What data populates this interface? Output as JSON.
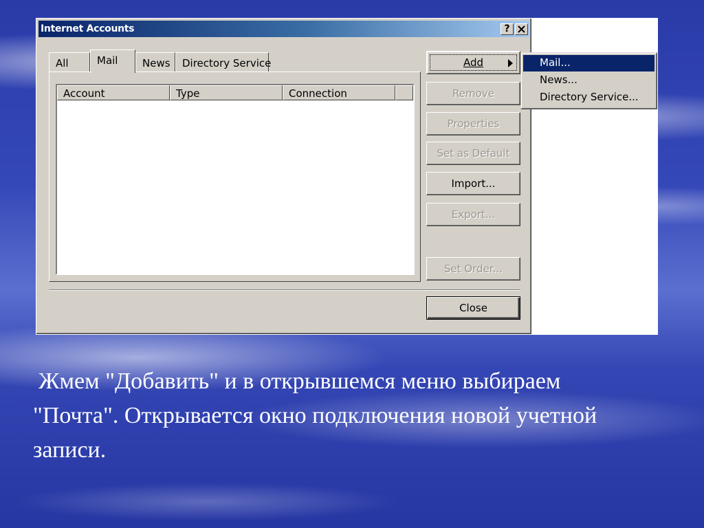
{
  "dialog": {
    "title": "Internet Accounts",
    "help_label": "?",
    "close_x_label": "✕",
    "tabs": [
      {
        "label": "All"
      },
      {
        "label": "Mail"
      },
      {
        "label": "News"
      },
      {
        "label": "Directory Service"
      }
    ],
    "active_tab": "Mail",
    "columns": [
      "Account",
      "Type",
      "Connection"
    ],
    "buttons": {
      "add": "Add",
      "remove": "Remove",
      "properties": "Properties",
      "set_default": "Set as Default",
      "import": "Import...",
      "export": "Export...",
      "set_order": "Set Order...",
      "close": "Close"
    }
  },
  "add_menu": {
    "items": [
      {
        "label": "Mail..."
      },
      {
        "label": "News..."
      },
      {
        "label": "Directory Service..."
      }
    ],
    "selected": "Mail..."
  },
  "caption": {
    "line1": "Жмем \"Добавить\" и в открывшемся меню выбираем",
    "line2": "\"Почта\". Открывается окно подключения новой учетной",
    "line3": "записи."
  },
  "colors": {
    "titlebar_start": "#0a246a",
    "titlebar_end": "#a6caf0",
    "dialog_face": "#d4d0c8",
    "menu_highlight": "#0a246a",
    "slide_background": "#2a3ba8"
  }
}
